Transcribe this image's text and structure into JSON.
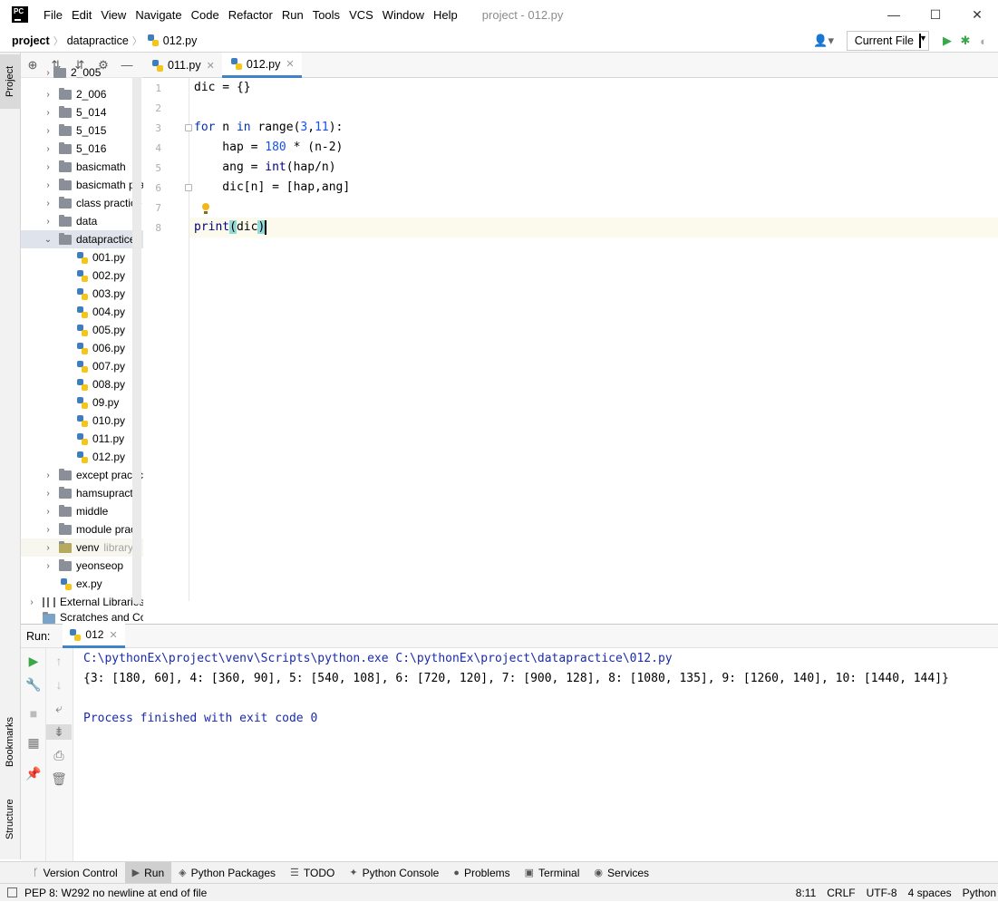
{
  "titlebar": {
    "logo": "PC",
    "menu": [
      "File",
      "Edit",
      "View",
      "Navigate",
      "Code",
      "Refactor",
      "Run",
      "Tools",
      "VCS",
      "Window",
      "Help"
    ],
    "window_title": "project - 012.py",
    "controls": [
      "—",
      "☐",
      "✕"
    ]
  },
  "navbar": {
    "crumbs": [
      "project",
      "datapractice",
      "012.py"
    ],
    "run_config": "Current File"
  },
  "left_stripe": {
    "project": "Project",
    "bookmarks": "Bookmarks",
    "structure": "Structure"
  },
  "tree": {
    "top_partial": "2_005",
    "folders_top": [
      "2_006",
      "5_014",
      "5_015",
      "5_016",
      "basicmath",
      "basicmath pra",
      "class practice",
      "data"
    ],
    "open_folder": "datapractice",
    "files": [
      "001.py",
      "002.py",
      "003.py",
      "004.py",
      "005.py",
      "006.py",
      "007.py",
      "008.py",
      "09.py",
      "010.py",
      "011.py",
      "012.py"
    ],
    "folders_bottom": [
      "except practic",
      "hamsupractic",
      "middle",
      "module pract"
    ],
    "venv": "venv",
    "venv_note": "library r",
    "last_folder": "yeonseop",
    "root_file": "ex.py",
    "external": "External Libraries",
    "scratches": "Scratches and Co"
  },
  "editor": {
    "tabs": [
      "011.py",
      "012.py"
    ],
    "line_numbers": [
      "1",
      "2",
      "3",
      "4",
      "5",
      "6",
      "7",
      "8"
    ],
    "code": {
      "l1": "dic = {}",
      "l3_kw": "for",
      "l3_a": " n ",
      "l3_in": "in",
      "l3_b": " range(",
      "l3_n1": "3",
      "l3_c": ",",
      "l3_n2": "11",
      "l3_d": "):",
      "l4_a": "    hap = ",
      "l4_n": "180",
      "l4_b": " * (n-2)",
      "l5_a": "    ang = ",
      "l5_bi": "int",
      "l5_b": "(hap/n)",
      "l6": "    dic[n] = [hap,ang]",
      "l8_fn": "print",
      "l8_p1": "(",
      "l8_arg": "dic",
      "l8_p2": ")"
    }
  },
  "run": {
    "label": "Run:",
    "tab": "012",
    "console": [
      "C:\\pythonEx\\project\\venv\\Scripts\\python.exe C:\\pythonEx\\project\\datapractice\\012.py",
      "{3: [180, 60], 4: [360, 90], 5: [540, 108], 6: [720, 120], 7: [900, 128], 8: [1080, 135], 9: [1260, 140], 10: [1440, 144]}",
      "Process finished with exit code 0"
    ]
  },
  "tool_tabs": [
    "Version Control",
    "Run",
    "Python Packages",
    "TODO",
    "Python Console",
    "Problems",
    "Terminal",
    "Services"
  ],
  "status": {
    "message": "PEP 8: W292 no newline at end of file",
    "position": "8:11",
    "line_sep": "CRLF",
    "encoding": "UTF-8",
    "indent": "4 spaces",
    "interpreter": "Python"
  },
  "colors": {
    "accent": "#4083c9",
    "keyword": "#0033b3",
    "number": "#1750eb",
    "console_blue": "#1a2ba8",
    "run_green": "#3aa84a"
  }
}
